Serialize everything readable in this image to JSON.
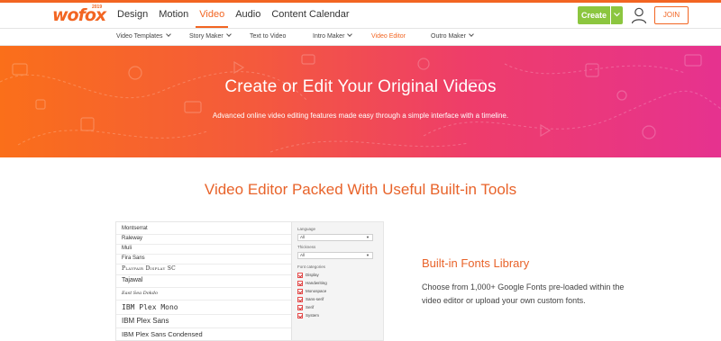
{
  "header": {
    "logo_text": "wofox",
    "logo_year": "2019",
    "nav": [
      {
        "label": "Design",
        "active": false
      },
      {
        "label": "Motion",
        "active": false
      },
      {
        "label": "Video",
        "active": true
      },
      {
        "label": "Audio",
        "active": false
      },
      {
        "label": "Content Calendar",
        "active": false
      }
    ],
    "create_label": "Create",
    "join_label": "JOIN"
  },
  "subnav": [
    {
      "label": "Video Templates",
      "dropdown": true,
      "active": false
    },
    {
      "label": "Story Maker",
      "dropdown": true,
      "active": false
    },
    {
      "label": "Text to Video",
      "dropdown": false,
      "active": false
    },
    {
      "label": "Intro Maker",
      "dropdown": true,
      "active": false
    },
    {
      "label": "Video Editor",
      "dropdown": false,
      "active": true
    },
    {
      "label": "Outro Maker",
      "dropdown": true,
      "active": false
    }
  ],
  "hero": {
    "title": "Create or Edit Your Original Videos",
    "subtitle": "Advanced online video editing features made easy through a simple interface with a timeline."
  },
  "section": {
    "title": "Video Editor Packed With Useful Built-in Tools"
  },
  "font_panel": {
    "fonts": [
      "Montserrat",
      "Raleway",
      "Muli",
      "Fira Sans",
      "Playfair Display SC",
      "Tajawal",
      "East Sea Dokdo",
      "IBM Plex Mono",
      "IBM Plex Sans",
      "IBM Plex Sans Condensed"
    ],
    "language_label": "Language",
    "language_value": "All",
    "thickness_label": "Thickness",
    "thickness_value": "All",
    "categories_label": "Font categories",
    "categories": [
      "Display",
      "Handwriting",
      "Monospace",
      "Sans-serif",
      "Serif",
      "System"
    ]
  },
  "feature": {
    "title": "Built-in Fonts Library",
    "description": "Choose from 1,000+ Google Fonts pre-loaded within the video editor or upload your own custom fonts."
  },
  "colors": {
    "brand_orange": "#f26522",
    "create_green": "#8cc63f",
    "hero_gradient_start": "#fa6f1a",
    "hero_gradient_end": "#e6328f",
    "section_title": "#e8632a"
  }
}
